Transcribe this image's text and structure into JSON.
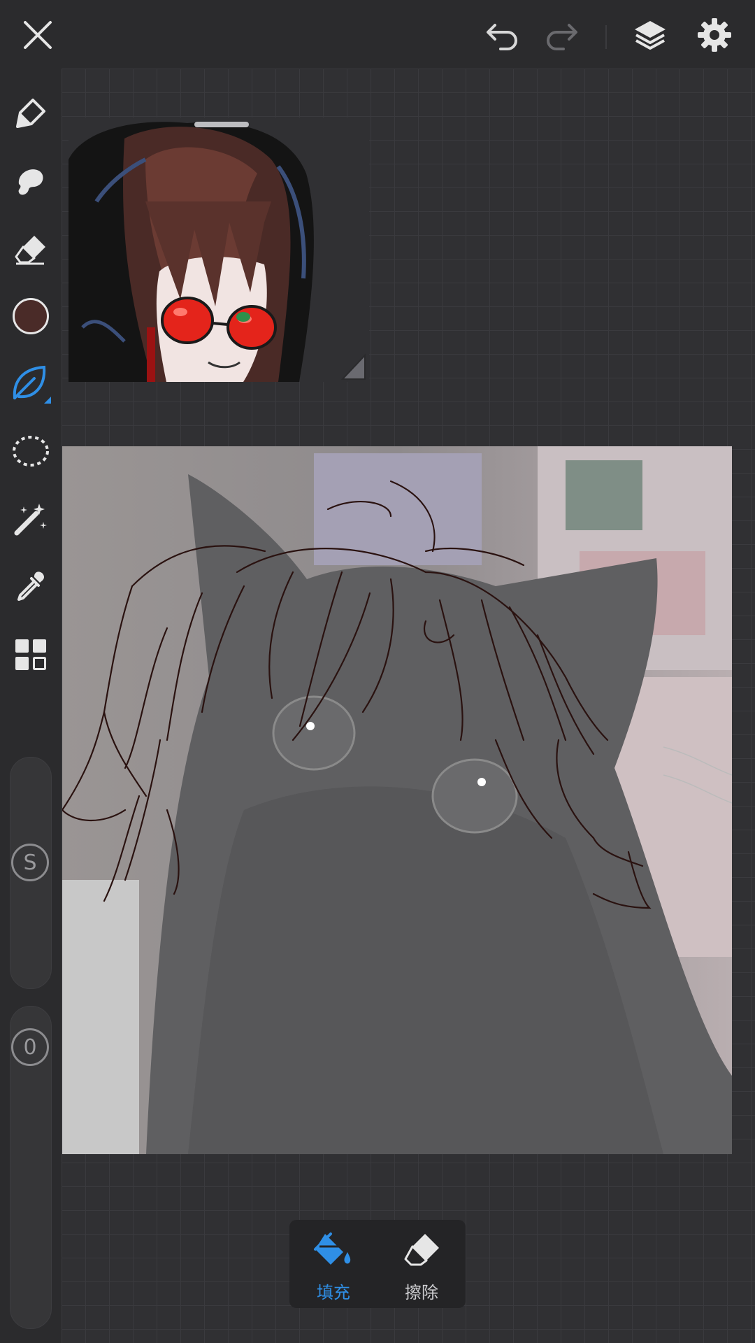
{
  "colors": {
    "background": "#2b2b2d",
    "grid_bg": "#303033",
    "accent_blue": "#2f8fe6",
    "current_color": "#4a2b28",
    "icon": "#e6e6e6",
    "icon_disabled": "#6a6a6e"
  },
  "topbar": {
    "close_icon": "close-icon",
    "undo_icon": "undo-icon",
    "redo_icon": "redo-icon",
    "layers_icon": "layers-icon",
    "settings_icon": "gear-icon"
  },
  "toolbar": {
    "tools": [
      "brush",
      "smudge",
      "eraser",
      "color",
      "fill-lasso-leaf",
      "lasso-select",
      "magic-wand",
      "eyedropper",
      "grid-menu"
    ],
    "active_tool": "fill-lasso-leaf",
    "size_knob_label": "S",
    "opacity_knob_label": "0"
  },
  "fill_panel": {
    "fill_label": "填充",
    "erase_label": "擦除",
    "active": "fill"
  }
}
